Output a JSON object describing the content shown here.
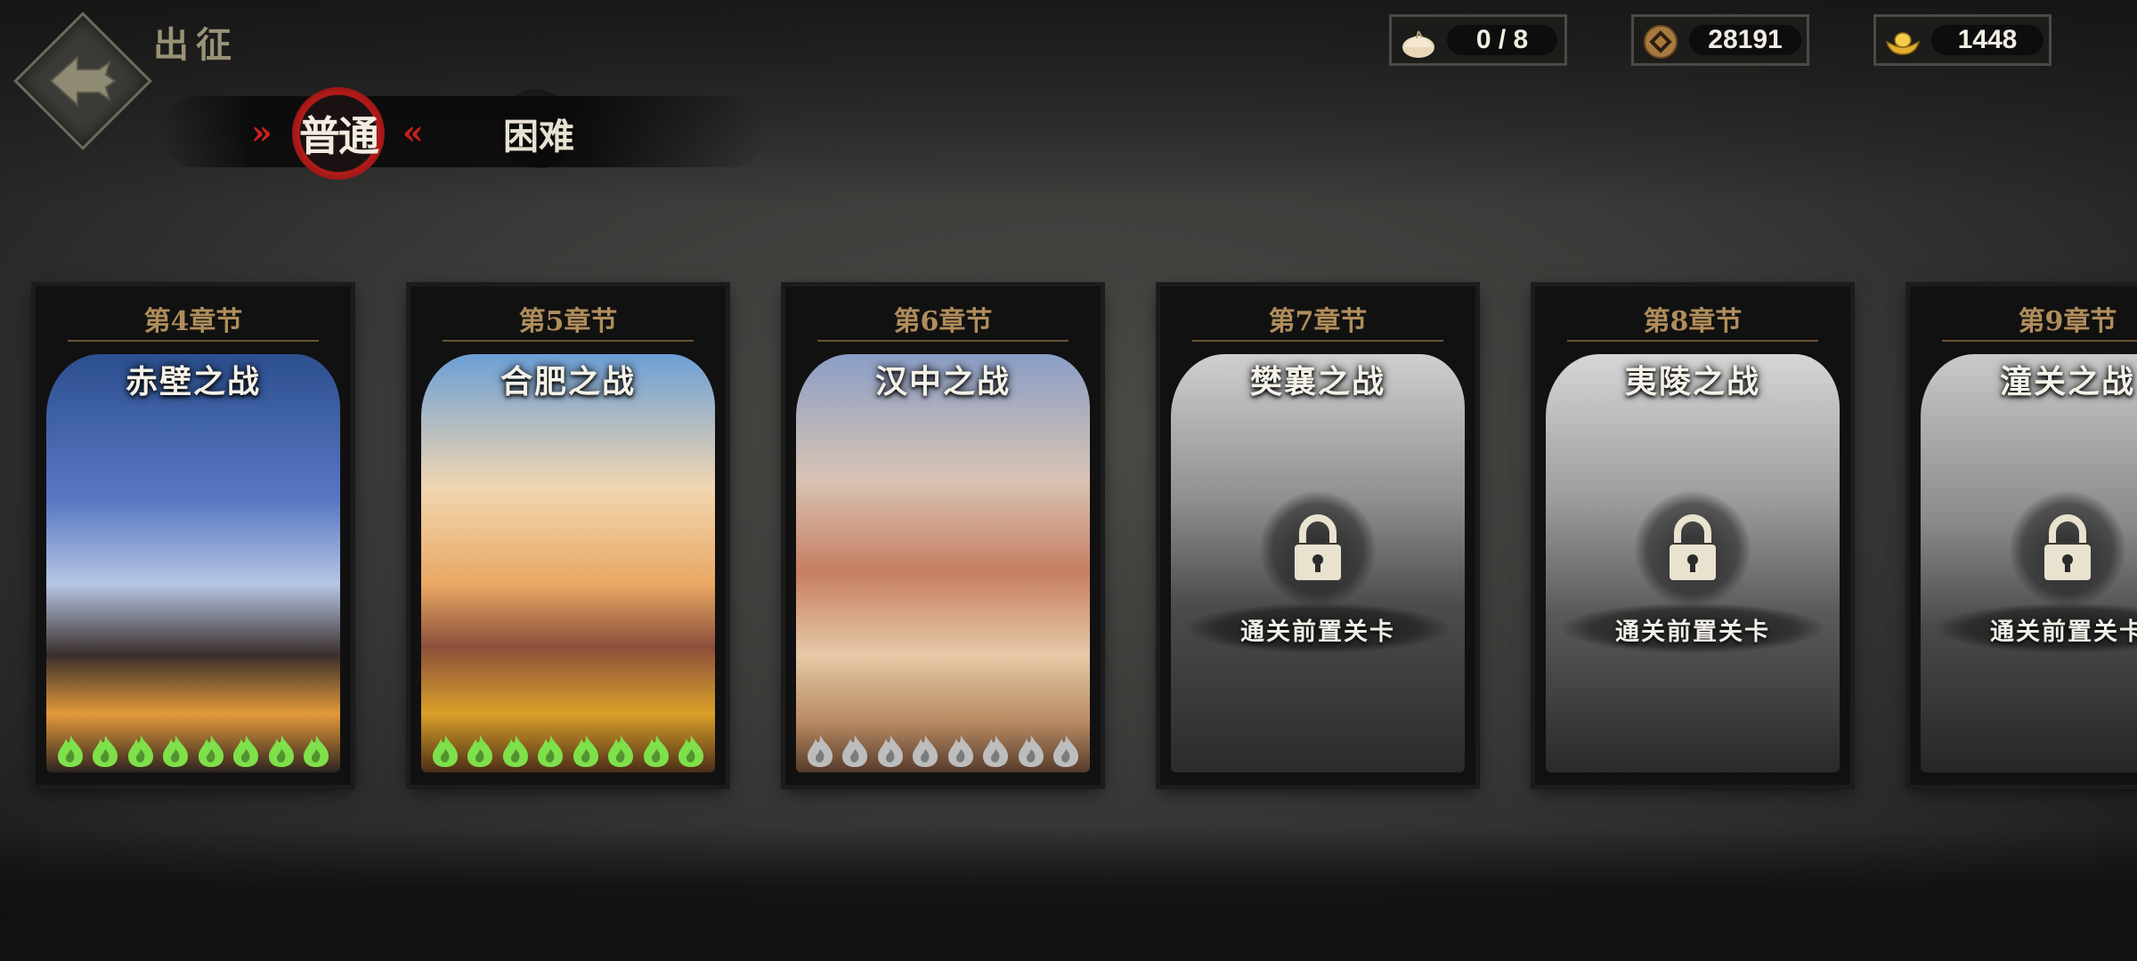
{
  "header": {
    "title": "出征",
    "back_icon": "arrow-left-icon"
  },
  "difficulty_tabs": {
    "normal": "普通",
    "hard": "困难",
    "selected": "normal"
  },
  "resources": [
    {
      "name": "stamina",
      "icon": "bun-icon",
      "value": "0 / 8"
    },
    {
      "name": "coins",
      "icon": "copper-coin-icon",
      "value": "28191"
    },
    {
      "name": "gold",
      "icon": "gold-ingot-icon",
      "value": "1448"
    }
  ],
  "colors": {
    "accent_red": "#c8211d",
    "chapter_gold": "#b08d5b",
    "flame_earned": "#7ee04a",
    "flame_empty": "#bdbdbd"
  },
  "chapters": [
    {
      "chapter": "第4章节",
      "title": "赤壁之战",
      "locked": false,
      "flames_earned": 8,
      "flames_total": 8
    },
    {
      "chapter": "第5章节",
      "title": "合肥之战",
      "locked": false,
      "flames_earned": 8,
      "flames_total": 8
    },
    {
      "chapter": "第6章节",
      "title": "汉中之战",
      "locked": false,
      "flames_earned": 0,
      "flames_total": 8
    },
    {
      "chapter": "第7章节",
      "title": "樊襄之战",
      "locked": true,
      "lock_text": "通关前置关卡"
    },
    {
      "chapter": "第8章节",
      "title": "夷陵之战",
      "locked": true,
      "lock_text": "通关前置关卡"
    },
    {
      "chapter": "第9章节",
      "title": "潼关之战",
      "locked": true,
      "lock_text": "通关前置关卡"
    }
  ]
}
